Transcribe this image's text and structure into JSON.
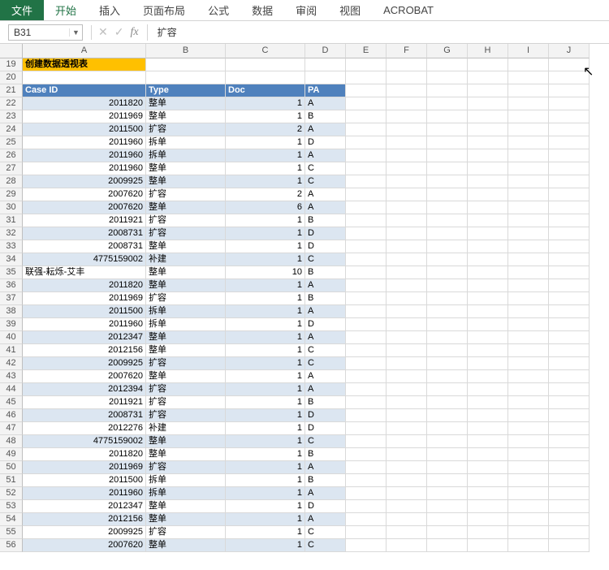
{
  "ribbon": {
    "file": "文件",
    "tabs": [
      "开始",
      "插入",
      "页面布局",
      "公式",
      "数据",
      "审阅",
      "视图",
      "ACROBAT"
    ]
  },
  "namebox": "B31",
  "formula": "扩容",
  "columns": [
    "A",
    "B",
    "C",
    "D",
    "E",
    "F",
    "G",
    "H",
    "I",
    "J"
  ],
  "row_start": 19,
  "title_cell": "创建数据透视表",
  "table_headers": [
    "Case ID",
    "Type",
    "Doc",
    "PA"
  ],
  "rows": [
    {
      "a": "2011820",
      "b": "整单",
      "c": "1",
      "d": "A"
    },
    {
      "a": "2011969",
      "b": "整单",
      "c": "1",
      "d": "B"
    },
    {
      "a": "2011500",
      "b": "扩容",
      "c": "2",
      "d": "A"
    },
    {
      "a": "2011960",
      "b": "拆单",
      "c": "1",
      "d": "D"
    },
    {
      "a": "2011960",
      "b": "拆单",
      "c": "1",
      "d": "A"
    },
    {
      "a": "2011960",
      "b": "整单",
      "c": "1",
      "d": "C"
    },
    {
      "a": "2009925",
      "b": "整单",
      "c": "1",
      "d": "C"
    },
    {
      "a": "2007620",
      "b": "扩容",
      "c": "2",
      "d": "A"
    },
    {
      "a": "2007620",
      "b": "整单",
      "c": "6",
      "d": "A"
    },
    {
      "a": "2011921",
      "b": "扩容",
      "c": "1",
      "d": "B"
    },
    {
      "a": "2008731",
      "b": "扩容",
      "c": "1",
      "d": "D"
    },
    {
      "a": "2008731",
      "b": "整单",
      "c": "1",
      "d": "D"
    },
    {
      "a": "4775159002",
      "b": "补建",
      "c": "1",
      "d": "C"
    },
    {
      "a": "联强-耘烁-艾丰",
      "b": "整单",
      "c": "10",
      "d": "B",
      "leftAlignA": true
    },
    {
      "a": "2011820",
      "b": "整单",
      "c": "1",
      "d": "A"
    },
    {
      "a": "2011969",
      "b": "扩容",
      "c": "1",
      "d": "B"
    },
    {
      "a": "2011500",
      "b": "拆单",
      "c": "1",
      "d": "A"
    },
    {
      "a": "2011960",
      "b": "拆单",
      "c": "1",
      "d": "D"
    },
    {
      "a": "2012347",
      "b": "整单",
      "c": "1",
      "d": "A"
    },
    {
      "a": "2012156",
      "b": "整单",
      "c": "1",
      "d": "C"
    },
    {
      "a": "2009925",
      "b": "扩容",
      "c": "1",
      "d": "C"
    },
    {
      "a": "2007620",
      "b": "整单",
      "c": "1",
      "d": "A"
    },
    {
      "a": "2012394",
      "b": "扩容",
      "c": "1",
      "d": "A"
    },
    {
      "a": "2011921",
      "b": "扩容",
      "c": "1",
      "d": "B"
    },
    {
      "a": "2008731",
      "b": "扩容",
      "c": "1",
      "d": "D"
    },
    {
      "a": "2012276",
      "b": "补建",
      "c": "1",
      "d": "D"
    },
    {
      "a": "4775159002",
      "b": "整单",
      "c": "1",
      "d": "C"
    },
    {
      "a": "2011820",
      "b": "整单",
      "c": "1",
      "d": "B"
    },
    {
      "a": "2011969",
      "b": "扩容",
      "c": "1",
      "d": "A"
    },
    {
      "a": "2011500",
      "b": "拆单",
      "c": "1",
      "d": "B"
    },
    {
      "a": "2011960",
      "b": "拆单",
      "c": "1",
      "d": "A"
    },
    {
      "a": "2012347",
      "b": "整单",
      "c": "1",
      "d": "D"
    },
    {
      "a": "2012156",
      "b": "整单",
      "c": "1",
      "d": "A"
    },
    {
      "a": "2009925",
      "b": "扩容",
      "c": "1",
      "d": "C"
    },
    {
      "a": "2007620",
      "b": "整单",
      "c": "1",
      "d": "C"
    }
  ]
}
